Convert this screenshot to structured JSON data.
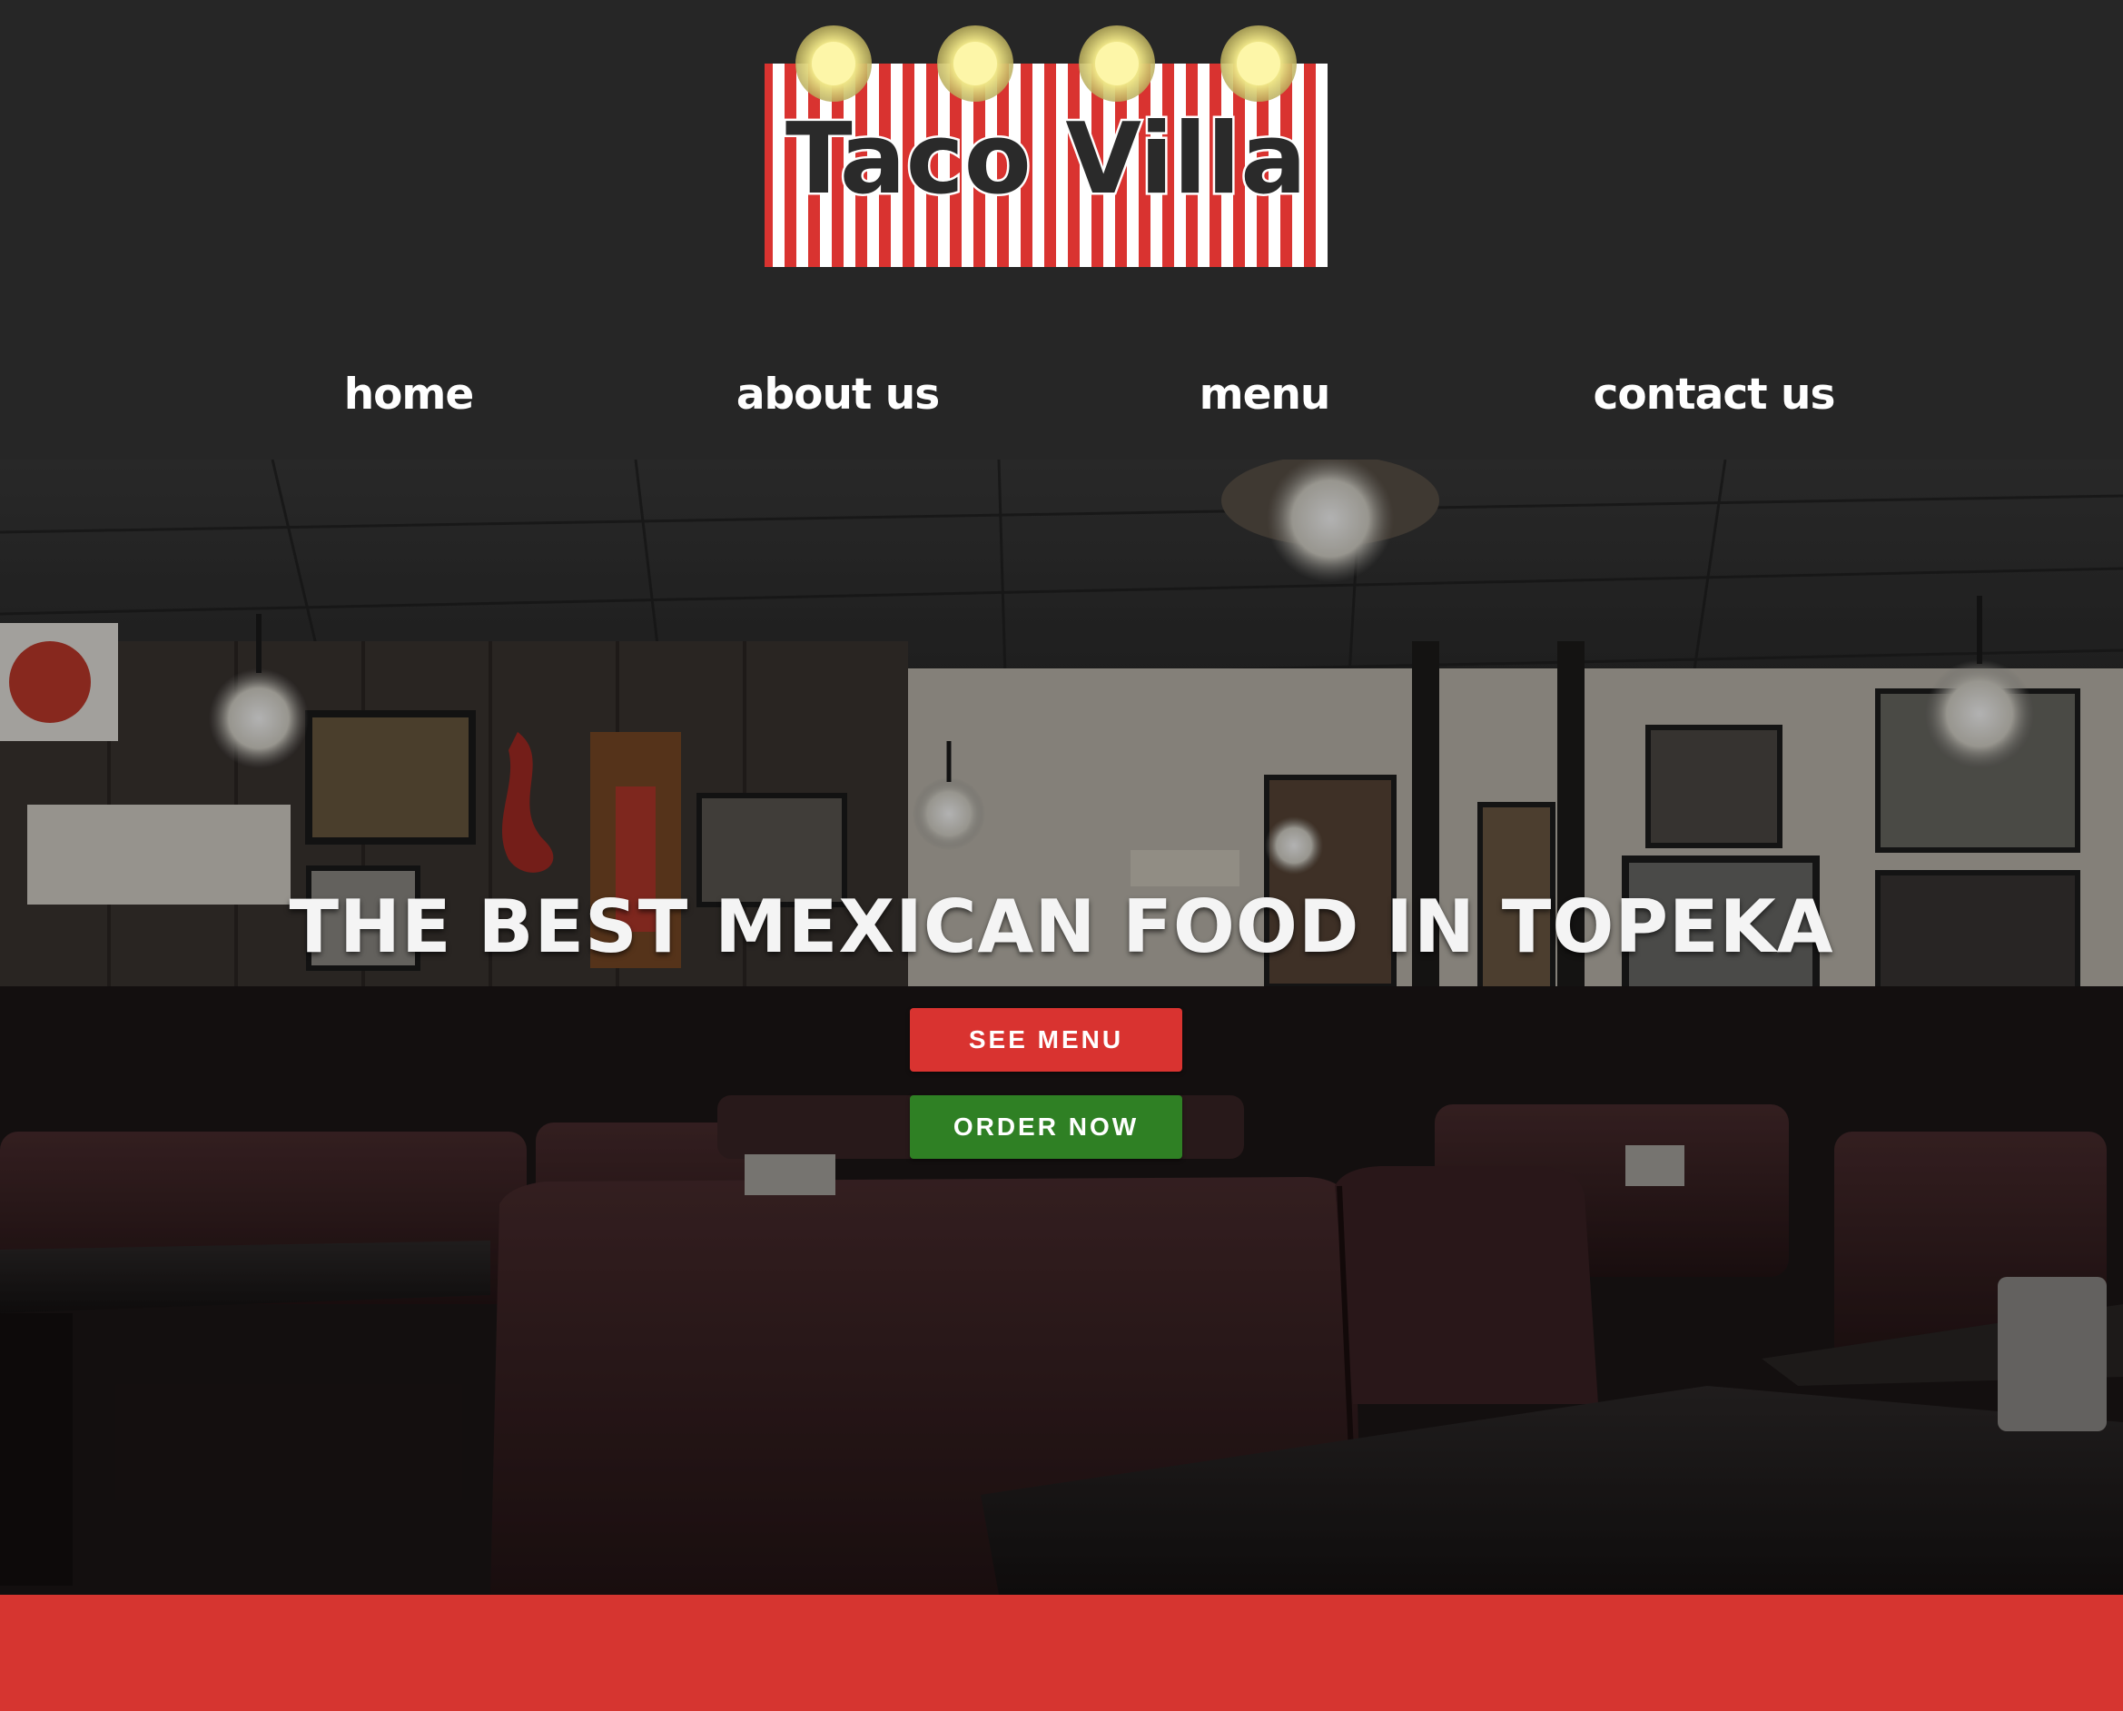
{
  "brand": {
    "name": "Taco Villa",
    "colors": {
      "red": "#d93330",
      "stripe_white": "#ffffff",
      "bulb": "#f3ea8a",
      "header_bg": "#262626"
    }
  },
  "nav": {
    "items": [
      {
        "label": "home"
      },
      {
        "label": "about us"
      },
      {
        "label": "menu"
      },
      {
        "label": "contact us"
      }
    ]
  },
  "hero": {
    "headline": "THE BEST MEXICAN FOOD IN TOPEKA",
    "buttons": {
      "see_menu": "SEE MENU",
      "order_now": "ORDER NOW"
    },
    "button_colors": {
      "see_menu": "#d93330",
      "order_now": "#2f8024"
    },
    "background": "dark restaurant dining room with booths"
  },
  "footer_band": {
    "color": "#d63530"
  }
}
